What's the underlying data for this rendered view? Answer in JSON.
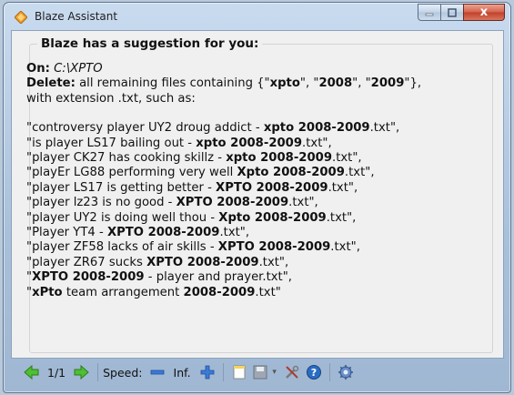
{
  "window": {
    "title": "Blaze Assistant",
    "close_glyph": "x"
  },
  "panel": {
    "heading": "Blaze has a suggestion for you:",
    "on_label": "On:",
    "on_value": "C:\\XPTO",
    "delete_label": "Delete:",
    "delete_text_a": " all remaining files containing {\"",
    "kw1": "xpto",
    "delete_text_b": "\", \"",
    "kw2": "2008",
    "delete_text_c": "\", \"",
    "kw3": "2009",
    "delete_text_d": "\"},",
    "delete_line2": "with extension .txt, such as:",
    "files": [
      {
        "pre": "\"controversy player UY2 droug addict - ",
        "bold": "xpto 2008-2009",
        "post": ".txt\","
      },
      {
        "pre": "\"is player LS17 bailing out - ",
        "bold": "xpto 2008-2009",
        "post": ".txt\","
      },
      {
        "pre": "\"player CK27 has cooking skillz - ",
        "bold": "xpto 2008-2009",
        "post": ".txt\","
      },
      {
        "pre": "\"playEr LG88 performing very well ",
        "bold": "Xpto 2008-2009",
        "post": ".txt\","
      },
      {
        "pre": "\"player LS17 is getting better - ",
        "bold": "XPTO 2008-2009",
        "post": ".txt\","
      },
      {
        "pre": "\"player lz23 is no good - ",
        "bold": "XPTO 2008-2009",
        "post": ".txt\","
      },
      {
        "pre": "\"player UY2 is doing well thou - ",
        "bold": "Xpto 2008-2009",
        "post": ".txt\","
      },
      {
        "pre": "\"Player YT4 - ",
        "bold": "XPTO 2008-2009",
        "post": ".txt\","
      },
      {
        "pre": "\"player ZF58 lacks of air skills - ",
        "bold": "XPTO 2008-2009",
        "post": ".txt\","
      },
      {
        "pre": "\"player ZR67 sucks ",
        "bold": "XPTO 2008-2009",
        "post": ".txt\","
      },
      {
        "pre": "\"",
        "bold": "XPTO 2008-2009",
        "post": " - player and prayer.txt\","
      },
      {
        "pre": "\"",
        "bold": "xPto",
        "post": " team arrangement ",
        "bold2": "2008-2009",
        "post2": ".txt\""
      }
    ]
  },
  "toolbar": {
    "page_indicator": "1/1",
    "speed_label": "Speed:",
    "speed_value": "Inf.",
    "icons": [
      "prev-arrow-icon",
      "next-arrow-icon",
      "minus-icon",
      "plus-icon",
      "note-icon",
      "save-icon",
      "tools-icon",
      "help-icon",
      "settings-icon"
    ]
  },
  "colors": {
    "accent_green": "#3fae2a",
    "window_frame": "#a9c0da",
    "client_bg": "#f0f0f0",
    "close_red": "#c1402a",
    "icon_blue": "#2a6cc4"
  }
}
